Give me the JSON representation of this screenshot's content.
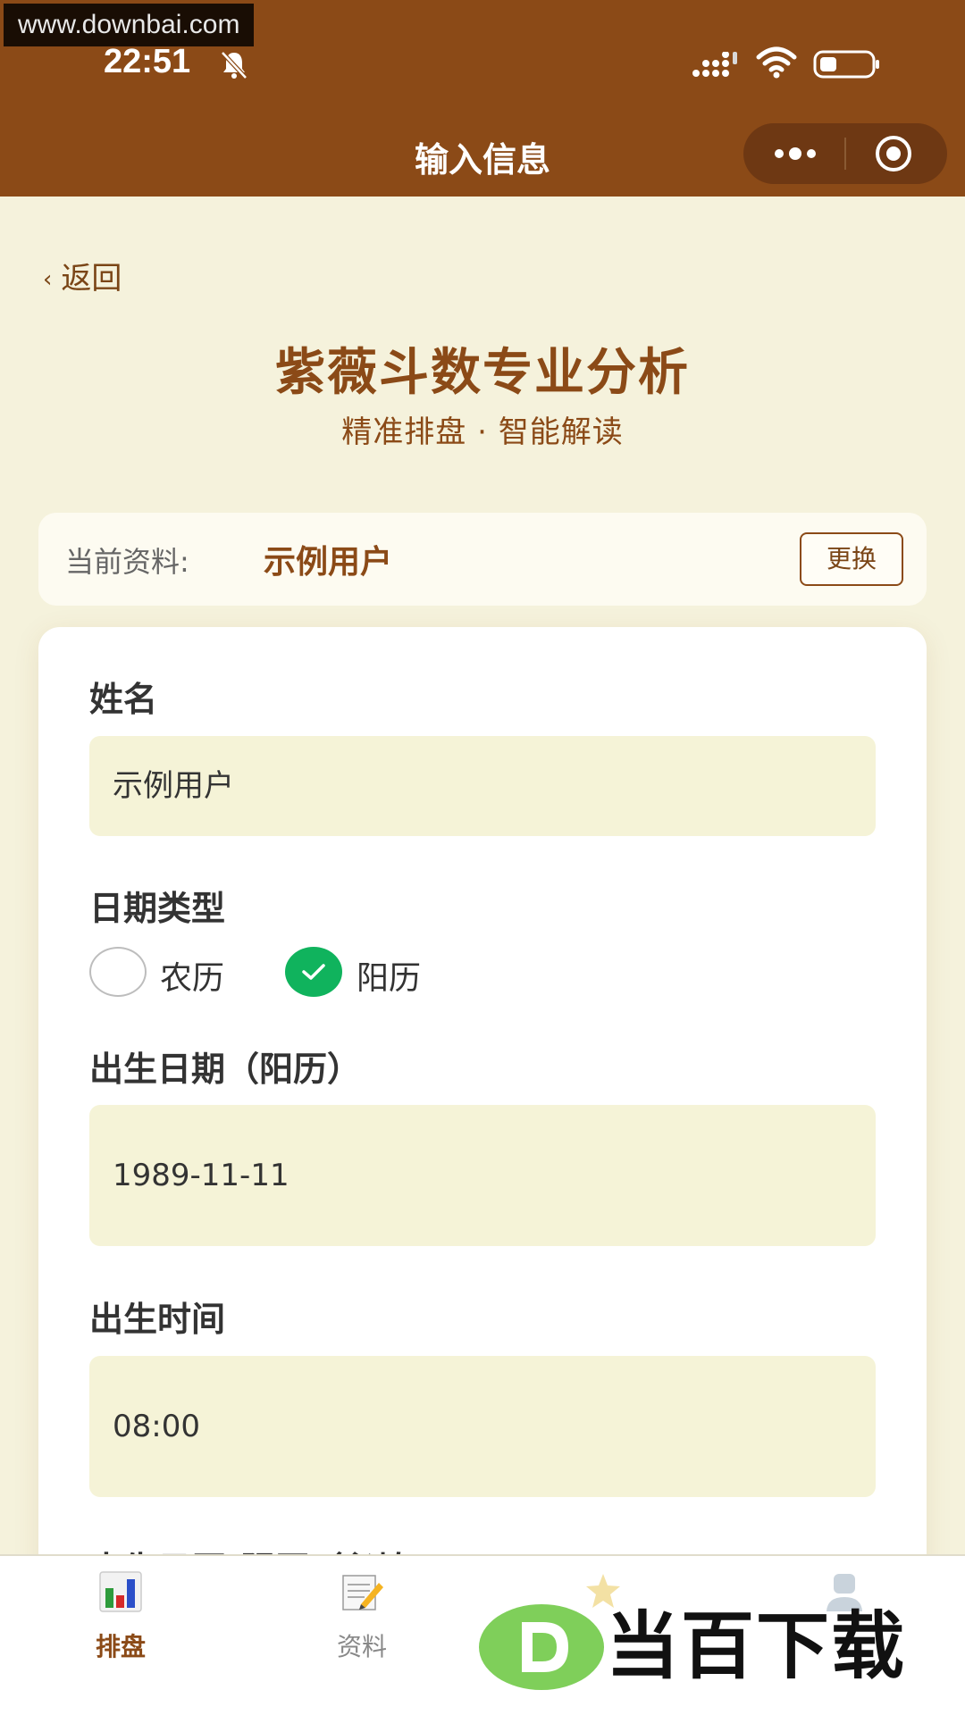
{
  "watermark": {
    "url": "www.downbai.com",
    "logo_text": "当百下载"
  },
  "status_bar": {
    "time": "22:51"
  },
  "nav": {
    "title": "输入信息"
  },
  "back": {
    "label": "返回"
  },
  "header": {
    "title": "紫薇斗数专业分析",
    "subtitle": "精准排盘 · 智能解读"
  },
  "profile": {
    "label": "当前资料:",
    "name": "示例用户",
    "change_label": "更换"
  },
  "form": {
    "name_label": "姓名",
    "name_value": "示例用户",
    "date_type_label": "日期类型",
    "date_type_options": [
      "农历",
      "阳历"
    ],
    "date_type_selected": "阳历",
    "birth_date_label": "出生日期（阳历）",
    "birth_date_value": "1989-11-11",
    "birth_time_label": "出生时间",
    "birth_time_value": "08:00",
    "next_label_partial": "出生日历(阴历（必填)"
  },
  "tabbar": {
    "items": [
      {
        "label": "排盘",
        "icon": "bar-chart-icon",
        "active": true
      },
      {
        "label": "资料",
        "icon": "notepad-pencil-icon",
        "active": false
      },
      {
        "label": "",
        "icon": "star-icon",
        "active": false
      },
      {
        "label": "",
        "icon": "user-icon",
        "active": false
      }
    ]
  },
  "colors": {
    "brand": "#8b4a17",
    "background": "#f5f2dc",
    "input_bg": "#f5f3d7",
    "radio_checked": "#10b35d"
  }
}
